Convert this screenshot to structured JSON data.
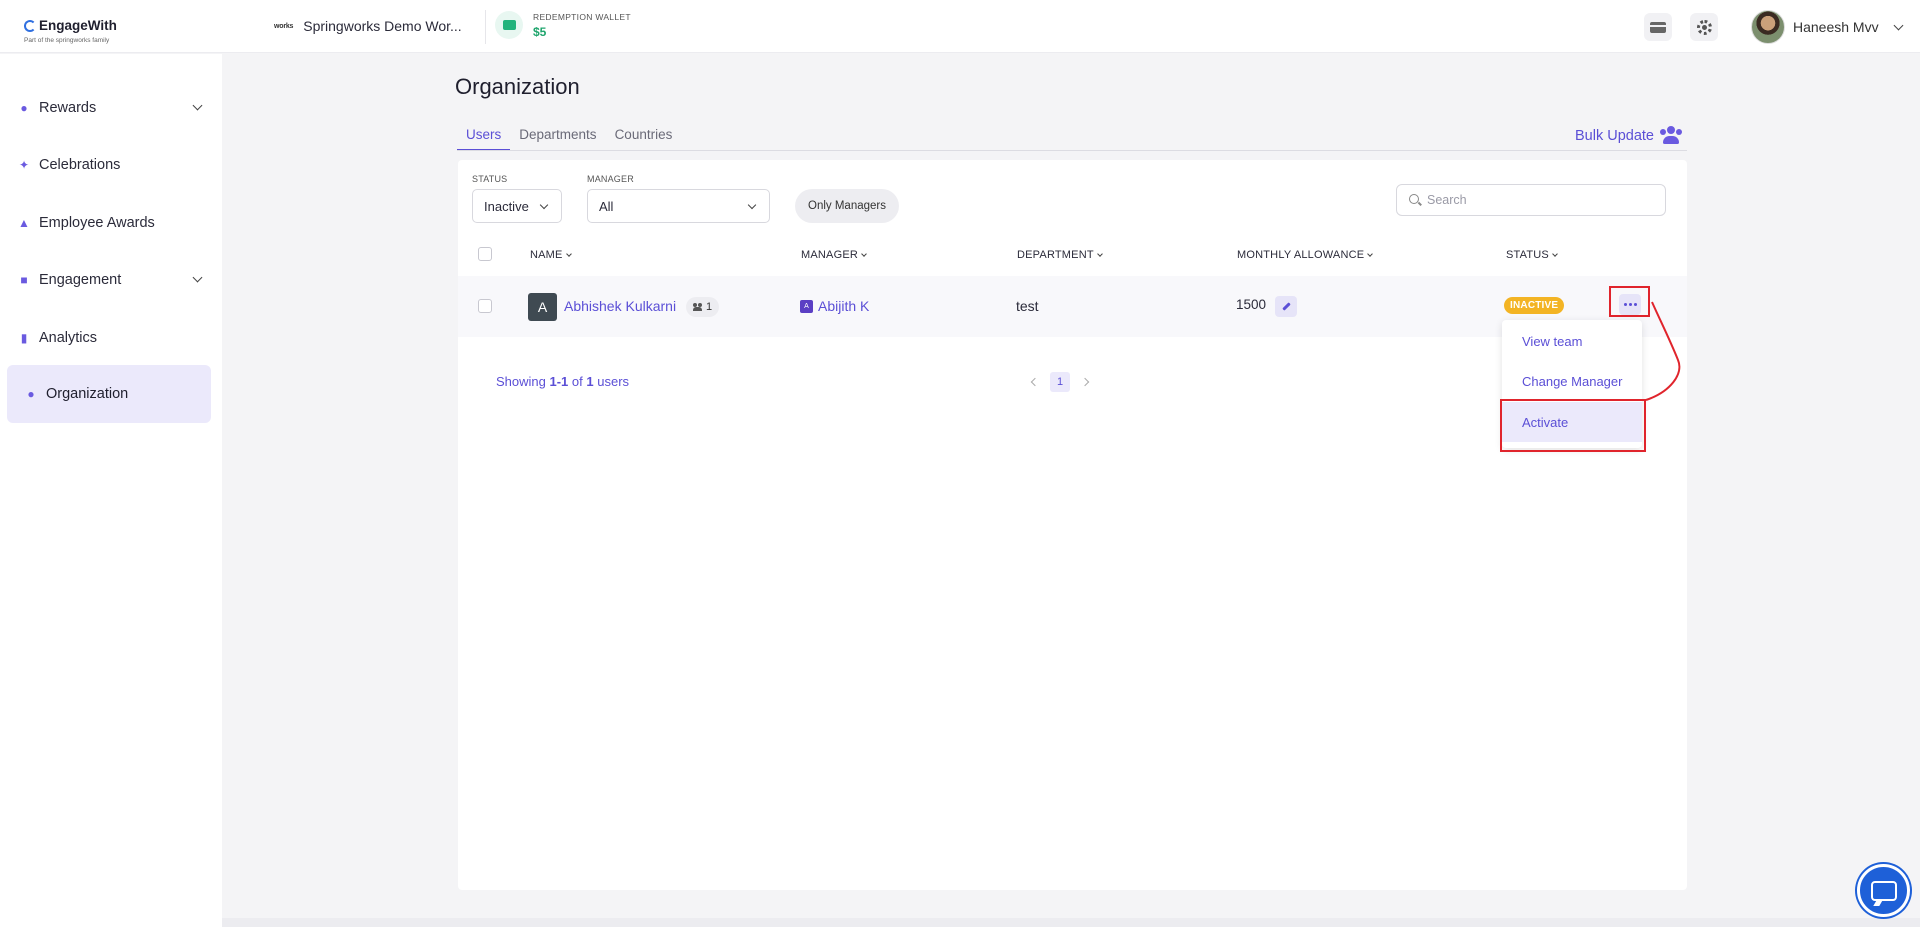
{
  "brand": {
    "name": "EngageWith",
    "tagline": "Part of the springworks family"
  },
  "header": {
    "workspace_logo": "works",
    "workspace_name": "Springworks Demo Wor...",
    "wallet_label": "REDEMPTION WALLET",
    "wallet_amount": "$5",
    "user_name": "Haneesh Mvv"
  },
  "sidebar": {
    "items": [
      {
        "label": "Rewards",
        "icon": "medal-icon",
        "expandable": true
      },
      {
        "label": "Celebrations",
        "icon": "party-icon",
        "expandable": false
      },
      {
        "label": "Employee Awards",
        "icon": "trophy-icon",
        "expandable": false
      },
      {
        "label": "Engagement",
        "icon": "engagement-icon",
        "expandable": true
      },
      {
        "label": "Analytics",
        "icon": "bar-chart-icon",
        "expandable": false
      },
      {
        "label": "Organization",
        "icon": "people-icon",
        "expandable": false,
        "active": true
      }
    ]
  },
  "page": {
    "title": "Organization",
    "tabs": [
      {
        "label": "Users",
        "active": true
      },
      {
        "label": "Departments"
      },
      {
        "label": "Countries"
      }
    ],
    "bulk_update_label": "Bulk Update"
  },
  "filters": {
    "status_label": "STATUS",
    "status_value": "Inactive",
    "manager_label": "MANAGER",
    "manager_value": "All",
    "only_managers_label": "Only Managers",
    "search_placeholder": "Search"
  },
  "table": {
    "columns": [
      "NAME",
      "MANAGER",
      "DEPARTMENT",
      "MONTHLY ALLOWANCE",
      "STATUS"
    ],
    "rows": [
      {
        "avatar_letter": "A",
        "name": "Abhishek Kulkarni",
        "team_count": "1",
        "manager_avatar_letter": "A",
        "manager": "Abijith K",
        "department": "test",
        "monthly_allowance": "1500",
        "status": "INACTIVE"
      }
    ]
  },
  "row_menu": {
    "items": [
      "View team",
      "Change Manager",
      "Activate"
    ]
  },
  "pagination": {
    "showing_prefix": "Showing",
    "range": "1-1",
    "of_text": "of",
    "total": "1",
    "suffix": "users",
    "current_page": "1"
  },
  "colors": {
    "accent": "#5b4fd6",
    "status_inactive": "#f3b424",
    "annotation": "#e0242c",
    "wallet": "#1fa56d"
  }
}
